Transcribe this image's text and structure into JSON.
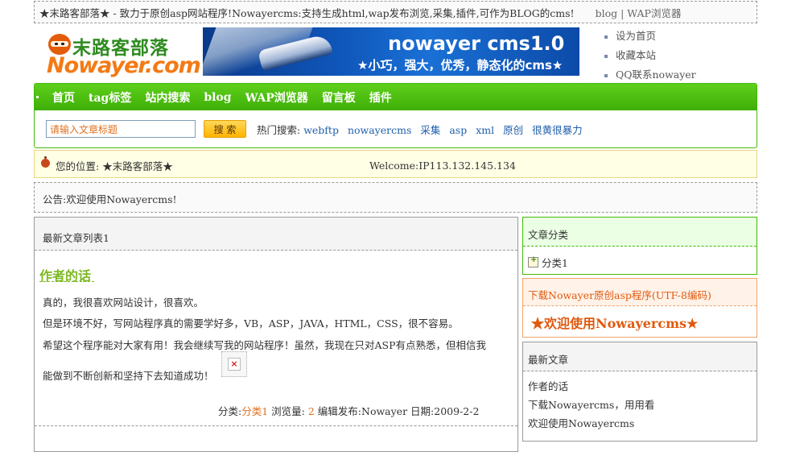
{
  "top": {
    "intro": "★末路客部落★ - 致力于原创asp网站程序!Nowayercms:支持生成html,wap发布浏览,采集,插件,可作为BLOG的cms!",
    "link_blog": "blog",
    "divider": "|",
    "link_wap": "WAP浏览器"
  },
  "logo": {
    "cn": "末路客部落",
    "en": "Nowayer.com"
  },
  "banner": {
    "title": "nowayer cms1.0",
    "subtitle": "★小巧，强大，优秀，静态化的cms★"
  },
  "quick_links": [
    "设为首页",
    "收藏本站",
    "QQ联系nowayer"
  ],
  "nav": [
    "首页",
    "tag标签",
    "站内搜索",
    "blog",
    "WAP浏览器",
    "留言板",
    "插件"
  ],
  "search": {
    "placeholder": "请输入文章标题",
    "button": "搜 索",
    "hot_label": "热门搜索:",
    "hot_keywords": [
      "webftp",
      "nowayercms",
      "采集",
      "asp",
      "xml",
      "原创",
      "很黄很暴力"
    ]
  },
  "location": {
    "label": "您的位置:",
    "site": "★末路客部落★",
    "welcome": "Welcome:IP113.132.145.134"
  },
  "notice": "公告:欢迎使用Nowayercms!",
  "main": {
    "header": "最新文章列表1",
    "article": {
      "title": "作者的话",
      "paragraphs": [
        "真的，我很喜欢网站设计，很喜欢。",
        "但是环境不好，写网站程序真的需要学好多，VB，ASP，JAVA，HTML，CSS，很不容易。",
        "希望这个程序能对大家有用！我会继续写我的网站程序！虽然，我现在只对ASP有点熟悉，但相信我",
        "能做到不断创新和坚持下去知道成功！"
      ],
      "meta": {
        "category_label": "分类:",
        "category": "分类1",
        "views_label": "浏览量:",
        "views": "2",
        "author": "编辑发布:Nowayer",
        "date": "日期:2009-2-2"
      }
    }
  },
  "sidebar": {
    "category": {
      "title": "文章分类",
      "item": "分类1"
    },
    "download": {
      "title": "下载Nowayer原创asp程序(UTF-8编码)",
      "promo": "★欢迎使用Nowayercms★"
    },
    "recent": {
      "title": "最新文章",
      "items": [
        "作者的话",
        "下载Nowayercms，用用看",
        "欢迎使用Nowayercms"
      ]
    }
  },
  "colors": {
    "nav_green": "#46b80a",
    "accent_orange": "#e05a10",
    "title_green": "#7cb822",
    "link_blue": "#1f5faa"
  },
  "icons": [
    "ninja-logo-icon",
    "ladybug-icon",
    "broken-image-icon",
    "folder-add-icon",
    "bullet-icon"
  ]
}
